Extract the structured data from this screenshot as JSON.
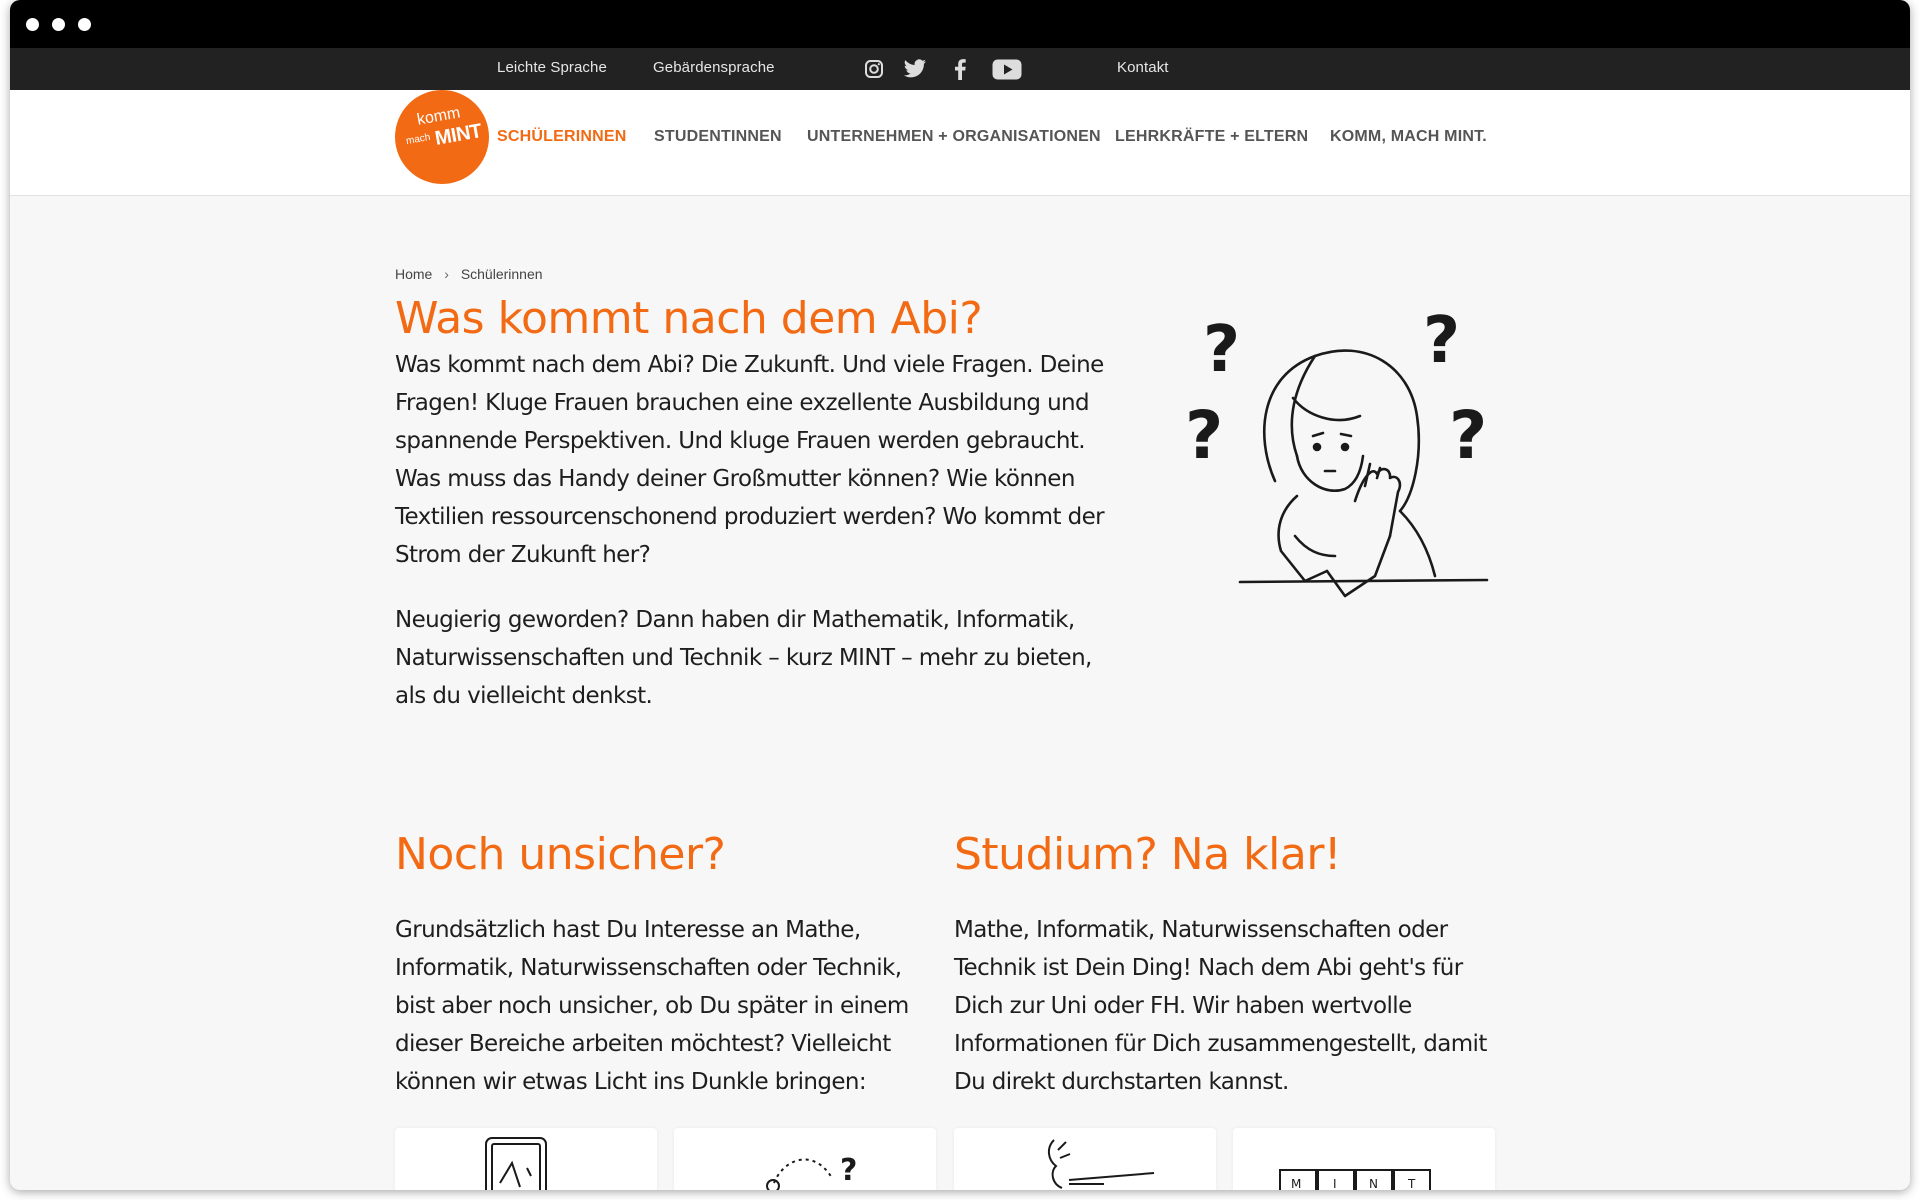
{
  "topbar": {
    "leichte_sprache": "Leichte Sprache",
    "gebaerdensprache": "Gebärdensprache",
    "social_icons": [
      "instagram-icon",
      "twitter-icon",
      "facebook-icon",
      "youtube-icon"
    ],
    "kontakt": "Kontakt"
  },
  "logo": {
    "line1": "komm",
    "line2": "mach",
    "line3": "MINT",
    "color": "#f26a13"
  },
  "nav": {
    "items": [
      "SCHÜLERINNEN",
      "STUDENTINNEN",
      "UNTERNEHMEN + ORGANISATIONEN",
      "LEHRKRÄFTE + ELTERN",
      "KOMM, MACH MINT."
    ],
    "active": "SCHÜLERINNEN"
  },
  "breadcrumb": {
    "home": "Home",
    "separator": "›",
    "current": "Schülerinnen"
  },
  "hero": {
    "title": "Was kommt nach dem Abi?",
    "paragraph1": "Was kommt nach dem Abi? Die Zukunft. Und viele Fragen. Deine Fragen! Kluge Frauen brauchen eine exzellente Ausbildung und spannende Perspektiven. Und kluge Frauen werden gebraucht. Was muss das Handy deiner Großmutter können? Wie können Textilien ressourcenschonend produziert werden? Wo kommt der Strom der Zukunft her?",
    "paragraph2": "Neugierig geworden? Dann haben dir Mathematik, Informatik, Naturwissenschaften und Technik – kurz MINT – mehr zu bieten, als du vielleicht denkst."
  },
  "sections": {
    "left_title": "Noch unsicher?",
    "left_text": "Grundsätzlich hast Du Interesse an Mathe, Informatik, Naturwissenschaften oder Technik, bist aber noch unsicher, ob Du später in einem dieser Bereiche arbeiten möchtest? Vielleicht können wir etwas Licht ins Dunkle bringen:",
    "right_title": "Studium? Na klar!",
    "right_text": "Mathe, Informatik, Naturwissenschaften oder Technik ist Dein Ding! Nach dem Abi geht's für Dich zur Uni oder FH. Wir haben wertvolle Informationen für Dich zusammengestellt, damit Du direkt durchstarten kannst."
  },
  "cards": {
    "card4_letters": [
      "M",
      "I",
      "N",
      "T"
    ]
  },
  "colors": {
    "accent": "#f26a13",
    "topbar": "#222222",
    "page_bg": "#f7f7f7"
  }
}
